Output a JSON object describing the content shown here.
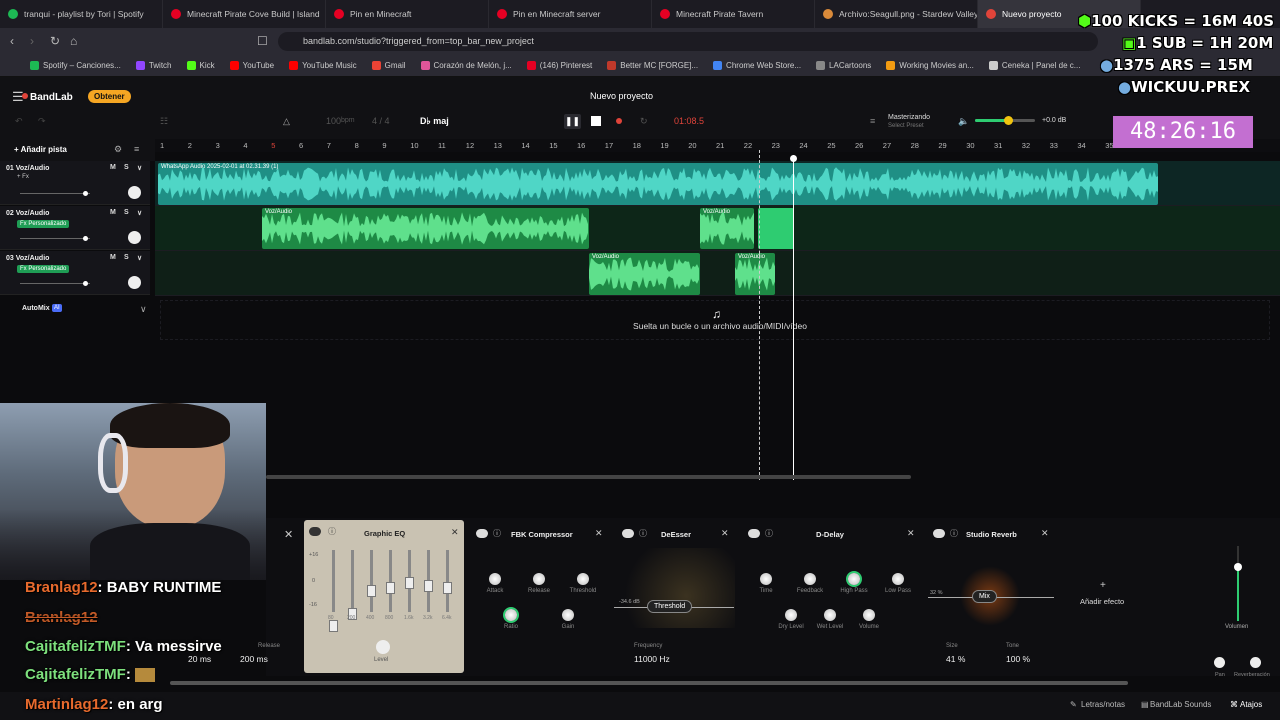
{
  "browser": {
    "tabs": [
      {
        "label": "tranqui - playlist by Tori | Spotify",
        "icon_color": "#1db954"
      },
      {
        "label": "Minecraft Pirate Cove Build | Island",
        "icon_color": "#e60023"
      },
      {
        "label": "Pin en Minecraft",
        "icon_color": "#e60023"
      },
      {
        "label": "Pin en Minecraft server",
        "icon_color": "#e60023"
      },
      {
        "label": "Minecraft Pirate Tavern",
        "icon_color": "#e60023"
      },
      {
        "label": "Archivo:Seagull.png - Stardew Valley",
        "icon_color": "#d98a3a"
      },
      {
        "label": "Nuevo proyecto",
        "icon_color": "#e0443a"
      }
    ],
    "url": "bandlab.com/studio?triggered_from=top_bar_new_project",
    "bookmarks": [
      {
        "label": "Spotify – Canciones...",
        "color": "#1db954"
      },
      {
        "label": "Twitch",
        "color": "#9146ff"
      },
      {
        "label": "Kick",
        "color": "#53fc18"
      },
      {
        "label": "YouTube",
        "color": "#ff0000"
      },
      {
        "label": "YouTube Music",
        "color": "#ff0000"
      },
      {
        "label": "Gmail",
        "color": "#ea4335"
      },
      {
        "label": "Corazón de Melón, j...",
        "color": "#e0559a"
      },
      {
        "label": "(146) Pinterest",
        "color": "#e60023"
      },
      {
        "label": "Better MC [FORGE]...",
        "color": "#c0392b"
      },
      {
        "label": "Chrome Web Store...",
        "color": "#4285f4"
      },
      {
        "label": "LACartoons",
        "color": "#888888"
      },
      {
        "label": "Working Movies an...",
        "color": "#f39c12"
      },
      {
        "label": "Ceneka | Panel de c...",
        "color": "#cccccc"
      }
    ]
  },
  "app": {
    "logo": "BandLab",
    "get_button": "Obtener",
    "project_name": "Nuevo proyecto",
    "bpm": "100",
    "bpm_unit": "bpm",
    "time_signature": "4 / 4",
    "key": "D♭ maj",
    "time_display": "01:08.5",
    "mastering": "Masterizando",
    "mastering_sub": "Select Preset",
    "master_db": "+0.0 dB",
    "add_track": "Añadir pista",
    "automix": "AutoMix",
    "drop_message": "Suelta un bucle o un archivo audio/MIDI/vídeo",
    "ruler_numbers": [
      "1",
      "2",
      "3",
      "4",
      "5",
      "6",
      "7",
      "8",
      "9",
      "10",
      "11",
      "12",
      "13",
      "14",
      "15",
      "16",
      "17",
      "18",
      "19",
      "20",
      "21",
      "22",
      "23",
      "24",
      "25",
      "26",
      "27",
      "28",
      "29",
      "30",
      "31",
      "32",
      "33",
      "34",
      "35"
    ],
    "tracks": [
      {
        "name": "01 Voz/Audio",
        "fx": "+ Fx",
        "badge": ""
      },
      {
        "name": "02 Voz/Audio",
        "fx": "",
        "badge": "Fx Personalizado"
      },
      {
        "name": "03 Voz/Audio",
        "fx": "",
        "badge": "Fx Personalizado"
      }
    ],
    "clip_labels": {
      "main": "WhatsApp Audio 2025-02-01 at 02.31.39 (1)",
      "voz": "Voz/Audio"
    }
  },
  "effects": {
    "eq": {
      "title": "Graphic EQ",
      "bands": [
        "80",
        "200",
        "400",
        "800",
        "1.6k",
        "3.2k",
        "6.4k"
      ],
      "level": "Level",
      "scale": [
        "+16",
        "0",
        "-16"
      ]
    },
    "compressor": {
      "title": "FBK Compressor",
      "knobs": [
        "Attack",
        "Release",
        "Threshold",
        "Ratio",
        "Gain"
      ],
      "attack_val": "20 ms",
      "release_val": "200 ms",
      "release_label": "Release"
    },
    "deesser": {
      "title": "DeEsser",
      "threshold": "Threshold",
      "db": "-34.6 dB",
      "freq_label": "Frequency",
      "freq_val": "11000 Hz"
    },
    "delay": {
      "title": "D-Delay",
      "knobs": [
        "Time",
        "Feedback",
        "High Pass",
        "Low Pass",
        "Dry Level",
        "Wet Level",
        "Volume"
      ]
    },
    "reverb": {
      "title": "Studio Reverb",
      "mix": "Mix",
      "mix_pct": "32 %",
      "size_label": "Size",
      "size_val": "41 %",
      "tone_label": "Tone",
      "tone_val": "100 %"
    },
    "add_effect": "Añadir efecto",
    "volume_label": "Volumen",
    "pan_label": "Pan",
    "reverb_label": "Reverberación"
  },
  "bottom_bar": {
    "lyrics": "Letras/notas",
    "sounds": "BandLab Sounds",
    "shortcuts": "Atajos"
  },
  "overlay": {
    "stats": [
      "100 KICKS = 16M 40S",
      "1 SUB = 1H 20M",
      "1375 ARS = 15M",
      "WICKUU.PREX"
    ],
    "timer": "48:26:16",
    "chat": [
      {
        "user": "Branlag12",
        "msg": ": BABY RUNTIME"
      },
      {
        "user": "Branlag12",
        "msg": ""
      },
      {
        "user": "CajitafelizTMF",
        "msg": ": Va messirve"
      },
      {
        "user": "CajitafelizTMF",
        "msg": ":"
      },
      {
        "user": "Martinlag12",
        "msg": ": en arg"
      }
    ]
  }
}
